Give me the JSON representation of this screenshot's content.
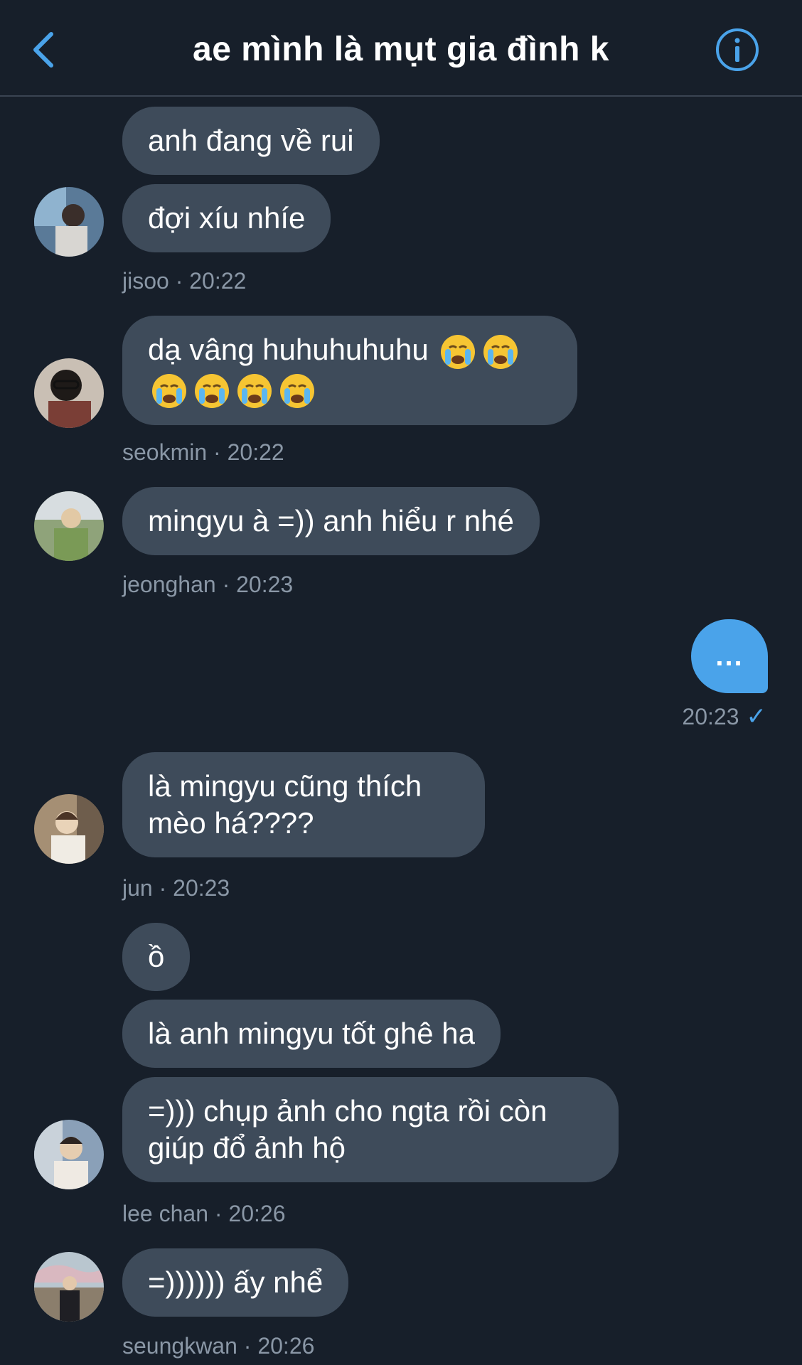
{
  "header": {
    "title": "ae mình là mụt gia đình k",
    "back_icon": "chevron-left-icon",
    "info_icon": "info-icon",
    "accent": "#4aa3ea"
  },
  "messages": [
    {
      "sender": "jisoo",
      "time": "jisoo · 20:22",
      "bubbles": [
        "anh đang về rui",
        "đợi xíu nhíe"
      ]
    },
    {
      "sender": "seokmin",
      "time": "seokmin · 20:22",
      "bubbles": [
        "dạ vâng huhuhuhuhu 😭 😭 😭 😭 😭 😭"
      ]
    },
    {
      "sender": "jeonghan",
      "time": "jeonghan · 20:23",
      "bubbles": [
        "mingyu à =)) anh hiểu r nhé"
      ]
    },
    {
      "sender": "jun",
      "time": "jun · 20:23",
      "bubbles": [
        "là mingyu cũng thích mèo há????"
      ]
    },
    {
      "sender": "lee chan",
      "time": "lee chan · 20:26",
      "bubbles": [
        "ồ",
        "là anh mingyu tốt ghê ha",
        "=))) chụp ảnh cho ngta rồi còn giúp đổ ảnh hộ"
      ]
    },
    {
      "sender": "seungkwan",
      "time": "seungkwan · 20:26",
      "bubbles": [
        "=)))))) ấy nhể"
      ]
    }
  ],
  "outgoing": {
    "text": "...",
    "time": "20:23",
    "status_icon": "check-icon"
  }
}
